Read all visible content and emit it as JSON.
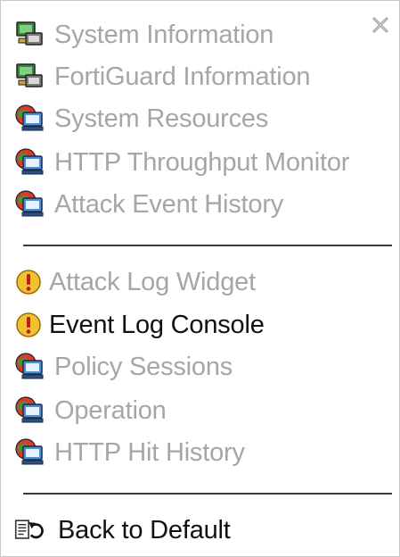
{
  "menu": {
    "groups": [
      {
        "items": [
          {
            "label": "System Information",
            "icon": "computer-icon",
            "enabled": false
          },
          {
            "label": "FortiGuard Information",
            "icon": "computer-icon",
            "enabled": false
          },
          {
            "label": "System Resources",
            "icon": "monitor-globe-icon",
            "enabled": false
          },
          {
            "label": "HTTP Throughput Monitor",
            "icon": "monitor-globe-icon",
            "enabled": false
          },
          {
            "label": "Attack Event History",
            "icon": "monitor-globe-icon",
            "enabled": false
          }
        ]
      },
      {
        "items": [
          {
            "label": "Attack Log Widget",
            "icon": "warning-icon",
            "enabled": false
          },
          {
            "label": "Event Log Console",
            "icon": "warning-icon",
            "enabled": true
          },
          {
            "label": "Policy Sessions",
            "icon": "monitor-globe-icon",
            "enabled": false
          },
          {
            "label": "Operation",
            "icon": "monitor-globe-icon",
            "enabled": false
          },
          {
            "label": "HTTP Hit History",
            "icon": "monitor-globe-icon",
            "enabled": false
          }
        ]
      }
    ],
    "footer": {
      "label": "Back to Default",
      "icon": "reset-icon"
    },
    "close_icon": "close-icon",
    "colors": {
      "disabled_text": "#a6a6a6",
      "enabled_text": "#111111",
      "separator": "#3a3a3a"
    }
  }
}
